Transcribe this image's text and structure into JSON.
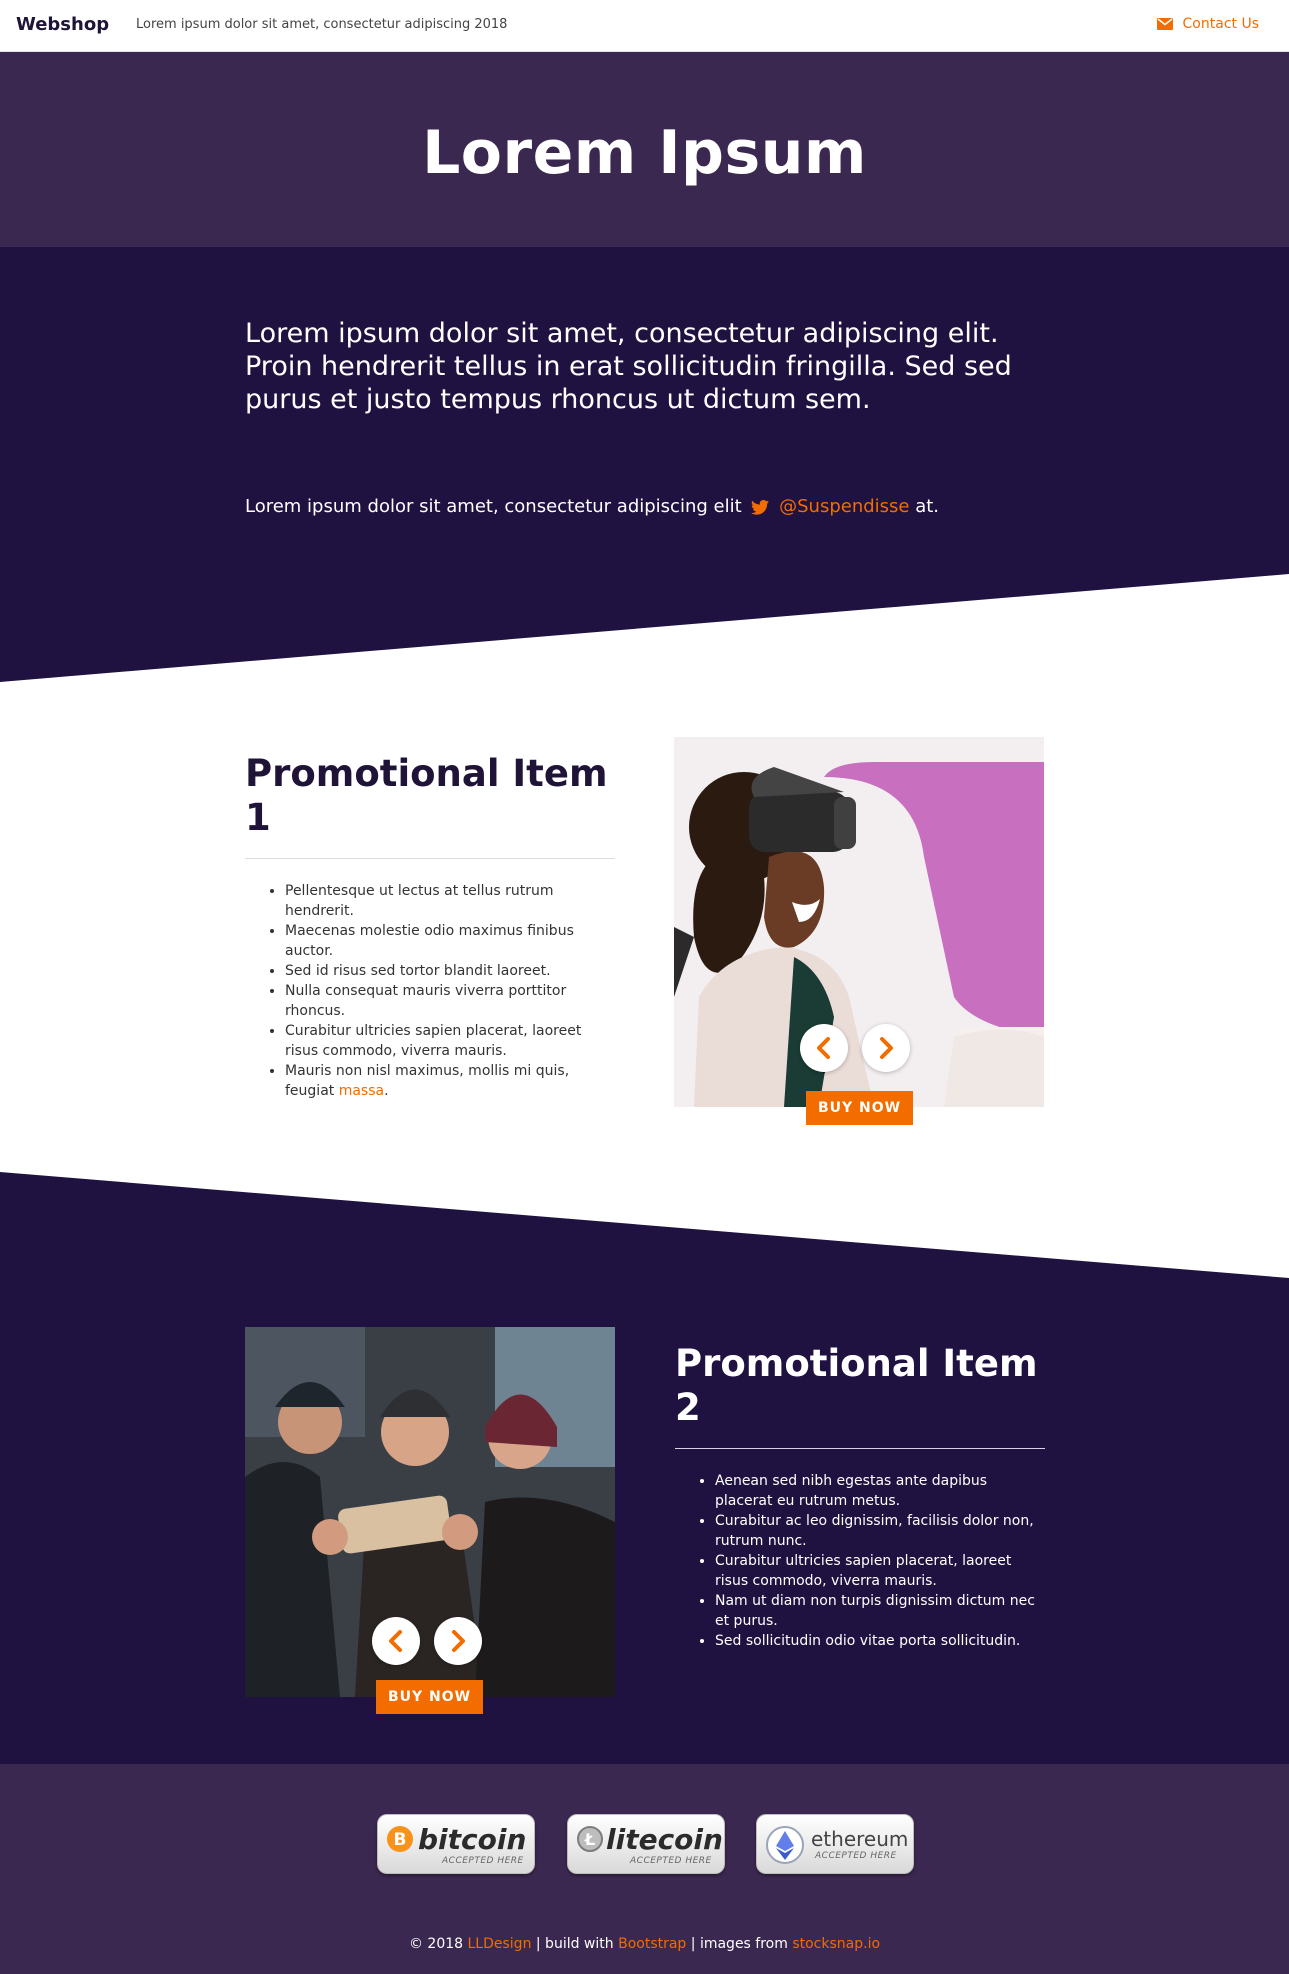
{
  "navbar": {
    "brand": "Webshop",
    "tagline": "Lorem ipsum dolor sit amet, consectetur adipiscing 2018",
    "contact_label": "Contact Us",
    "contact_icon": "mail-icon"
  },
  "hero": {
    "title": "Lorem Ipsum"
  },
  "intro": {
    "lead": "Lorem ipsum dolor sit amet, consectetur adipiscing elit. Proin hendrerit tellus in erat sollicitudin fringilla. Sed sed purus et justo tempus rhoncus ut dictum sem.",
    "tweet_prefix": "Lorem ipsum dolor sit amet, consectetur adipiscing elit",
    "tweet_icon": "twitter-icon",
    "tweet_handle": "@Suspendisse",
    "tweet_suffix": " at."
  },
  "promo1": {
    "title": "Promotional Item 1",
    "items": [
      "Pellentesque ut lectus at tellus rutrum hendrerit.",
      "Maecenas molestie odio maximus finibus auctor.",
      "Sed id risus sed tortor blandit laoreet.",
      "Nulla consequat mauris viverra porttitor rhoncus.",
      "Curabitur ultricies sapien placerat, laoreet risus commodo, viverra mauris."
    ],
    "last_item_text": "Mauris non nisl maximus, mollis mi quis, feugiat ",
    "last_item_link": "massa",
    "last_item_end": ".",
    "buy_label": "BUY NOW"
  },
  "promo2": {
    "title": "Promotional Item 2",
    "items": [
      "Aenean sed nibh egestas ante dapibus placerat eu rutrum metus.",
      "Curabitur ac leo dignissim, facilisis dolor non, rutrum nunc.",
      "Curabitur ultricies sapien placerat, laoreet risus commodo, viverra mauris.",
      "Nam ut diam non turpis dignissim dictum nec et purus.",
      "Sed sollicitudin odio vitae porta sollicitudin."
    ],
    "buy_label": "BUY NOW"
  },
  "footer": {
    "badges": [
      {
        "name": "bitcoin",
        "sub": "ACCEPTED HERE",
        "icon": "bitcoin-icon"
      },
      {
        "name": "litecoin",
        "sub": "ACCEPTED HERE",
        "icon": "litecoin-icon"
      },
      {
        "name": "ethereum",
        "sub": "ACCEPTED HERE",
        "icon": "ethereum-icon"
      }
    ],
    "credits_prefix": "© 2018 ",
    "credits_author": "LLDesign",
    "credits_mid1": " | build with ",
    "credits_framework": "Bootstrap",
    "credits_mid2": " | images from ",
    "credits_source": "stocksnap.io"
  },
  "colors": {
    "accent": "#f26c00",
    "dark_purple": "#201240",
    "mid_purple": "#3b2850"
  }
}
